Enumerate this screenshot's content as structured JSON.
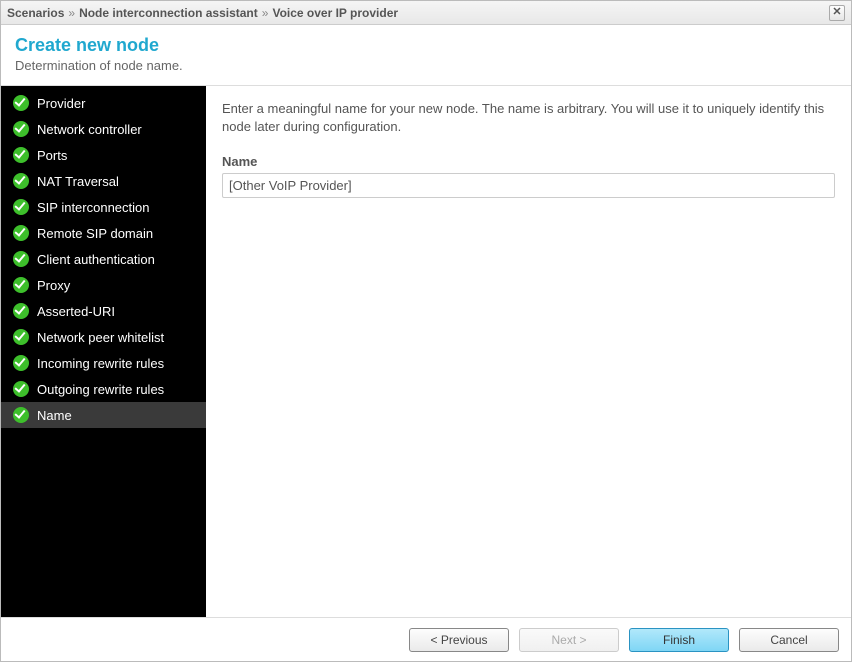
{
  "breadcrumb": [
    "Scenarios",
    "Node interconnection assistant",
    "Voice over IP provider"
  ],
  "header": {
    "title": "Create new node",
    "subtitle": "Determination of node name."
  },
  "sidebar": {
    "steps": [
      {
        "label": "Provider",
        "done": true,
        "active": false
      },
      {
        "label": "Network controller",
        "done": true,
        "active": false
      },
      {
        "label": "Ports",
        "done": true,
        "active": false
      },
      {
        "label": "NAT Traversal",
        "done": true,
        "active": false
      },
      {
        "label": "SIP interconnection",
        "done": true,
        "active": false
      },
      {
        "label": "Remote SIP domain",
        "done": true,
        "active": false
      },
      {
        "label": "Client authentication",
        "done": true,
        "active": false
      },
      {
        "label": "Proxy",
        "done": true,
        "active": false
      },
      {
        "label": "Asserted-URI",
        "done": true,
        "active": false
      },
      {
        "label": "Network peer whitelist",
        "done": true,
        "active": false
      },
      {
        "label": "Incoming rewrite rules",
        "done": true,
        "active": false
      },
      {
        "label": "Outgoing rewrite rules",
        "done": true,
        "active": false
      },
      {
        "label": "Name",
        "done": true,
        "active": true
      }
    ]
  },
  "main": {
    "instructions": "Enter a meaningful name for your new node. The name is arbitrary. You will use it to uniquely identify this node later during configuration.",
    "name_label": "Name",
    "name_value": "[Other VoIP Provider]"
  },
  "footer": {
    "previous": "< Previous",
    "next": "Next >",
    "finish": "Finish",
    "cancel": "Cancel",
    "next_disabled": true
  }
}
